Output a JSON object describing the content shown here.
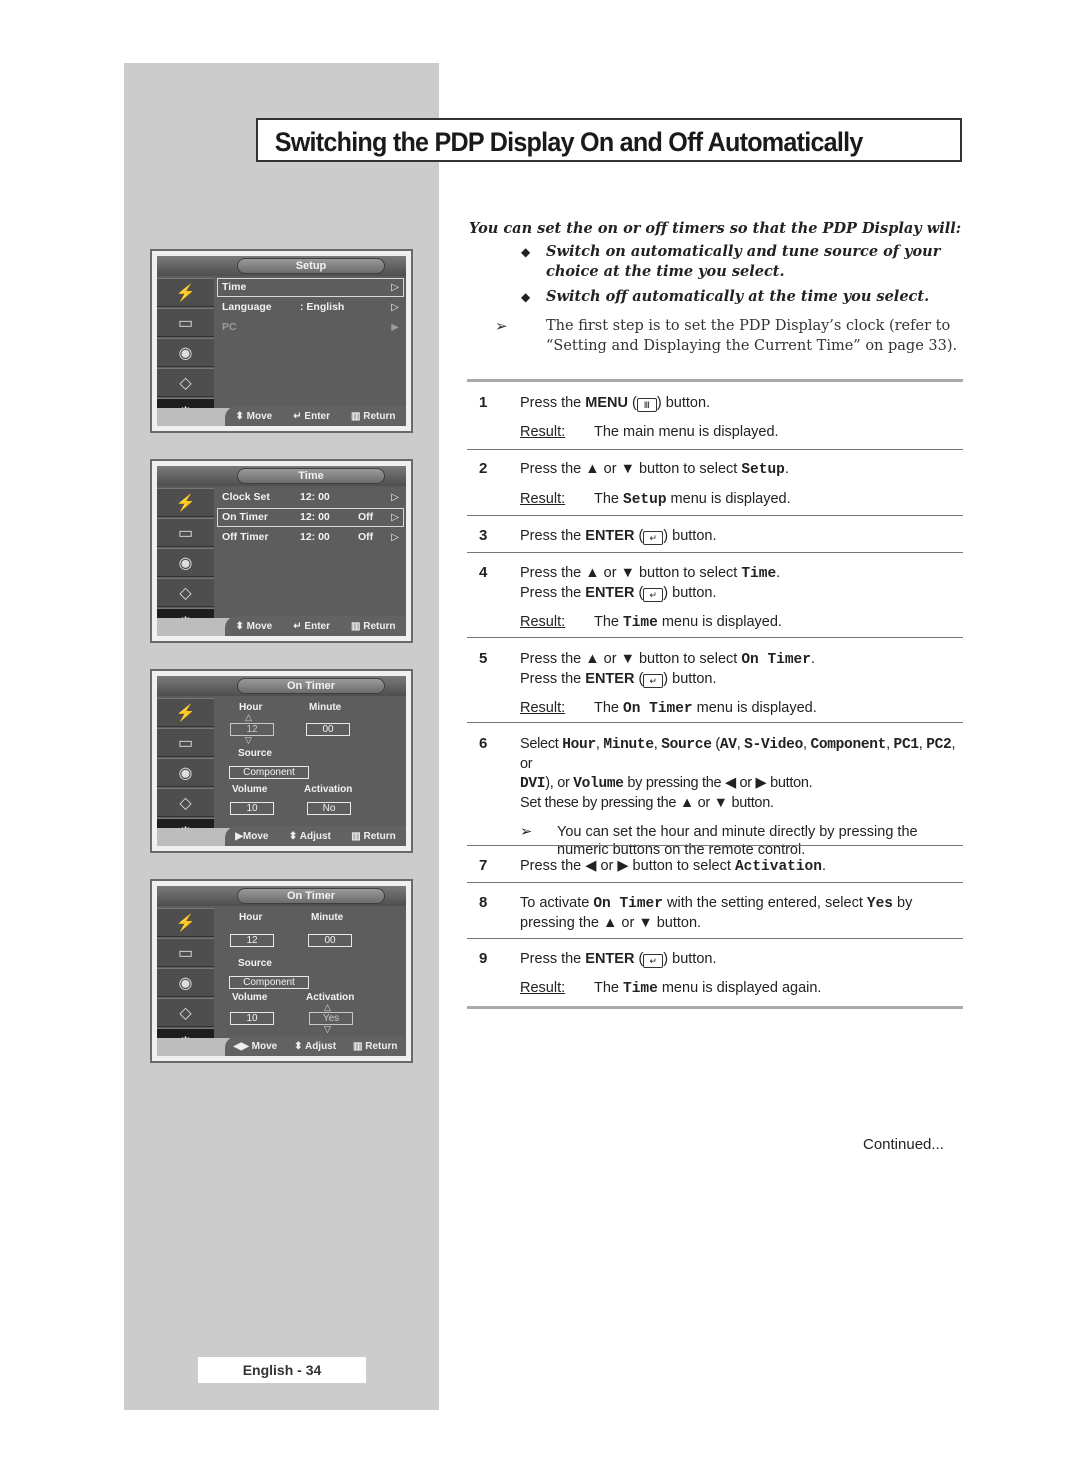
{
  "page": {
    "title": "Switching the PDP Display On and Off Automatically",
    "page_number": "English - 34",
    "continued": "Continued..."
  },
  "intro": {
    "lead": "You can set the on or off timers so that the PDP Display will:",
    "bullets": [
      "Switch on automatically and tune source of your choice at the time you select.",
      "Switch off automatically at the time you select."
    ],
    "note": "The first step is to set the PDP Display’s clock (refer to “Setting and Displaying the Current Time” on page 33)."
  },
  "symbols": {
    "diamond": "◆",
    "arrow_note": "➢",
    "up": "▲",
    "down": "▼",
    "left": "◀",
    "right": "▶",
    "menu_icon": "▥",
    "enter_icon": "↵"
  },
  "result_label": "Result:",
  "steps": [
    {
      "num": "1",
      "parts": [
        "Press the ",
        "MENU",
        " (",
        ") button."
      ],
      "result": "The main menu is displayed."
    },
    {
      "num": "2",
      "text": "Press the ▲ or ▼ button to select ",
      "code": "Setup",
      "tail": ".",
      "result_pre": "The ",
      "result_code": "Setup",
      "result_post": " menu is displayed."
    },
    {
      "num": "3",
      "parts": [
        "Press the ",
        "ENTER",
        " (",
        ") button."
      ]
    },
    {
      "num": "4",
      "text": "Press the ▲ or ▼ button to select ",
      "code": "Time",
      "tail": ".",
      "line2": [
        "Press the ",
        "ENTER",
        " (",
        ") button."
      ],
      "result_pre": "The ",
      "result_code": "Time",
      "result_post": " menu is displayed."
    },
    {
      "num": "5",
      "text": "Press the ▲ or ▼ button to select ",
      "code": "On Timer",
      "tail": ".",
      "line2": [
        "Press the ",
        "ENTER",
        " (",
        ") button."
      ],
      "result_pre": "The ",
      "result_code": "On Timer",
      "result_post": " menu is displayed."
    },
    {
      "num": "6",
      "select": "Select ",
      "c1": "Hour",
      "s1": ", ",
      "c2": "Minute",
      "s2": ", ",
      "c3": "Source",
      "s3": " (",
      "c4": "AV",
      "s4": ", ",
      "c5": "S-Video",
      "s5": ", ",
      "c6": "Component",
      "s6": ", ",
      "c7": "PC1",
      "s7": ", ",
      "c8": "PC2",
      "s8": ", or",
      "c9": "DVI",
      "s9": "), or ",
      "c10": "Volume",
      "s10": " by pressing the ◀ or ▶ button.",
      "line3": "Set these by pressing the ▲ or ▼ button.",
      "note": "You can set the hour and minute directly by pressing the numeric buttons on the remote control."
    },
    {
      "num": "7",
      "text": "Press the ◀ or ▶ button to select ",
      "code": "Activation",
      "tail": "."
    },
    {
      "num": "8",
      "pre": "To activate ",
      "code": "On Timer",
      "mid": " with the setting entered, select ",
      "code2": "Yes",
      "post": " by pressing the ▲ or ▼ button."
    },
    {
      "num": "9",
      "parts": [
        "Press the ",
        "ENTER",
        " (",
        ") button."
      ],
      "result_pre": "The ",
      "result_code": "Time",
      "result_post": " menu is displayed again."
    }
  ],
  "osd": {
    "footer_a": {
      "move": "Move",
      "enter": "Enter",
      "return": "Return"
    },
    "footer_b": {
      "move": "Move",
      "adjust": "Adjust",
      "return": "Return"
    },
    "setup": {
      "title": "Setup",
      "rows": [
        {
          "label": "Time",
          "value": "",
          "selected": true
        },
        {
          "label": "Language",
          "value": ": English"
        },
        {
          "label": "PC",
          "value": "",
          "disabled": true
        }
      ]
    },
    "time": {
      "title": "Time",
      "rows": [
        {
          "label": "Clock Set",
          "value": "12: 00",
          "state": ""
        },
        {
          "label": "On Timer",
          "value": "12: 00",
          "state": "Off",
          "selected": true
        },
        {
          "label": "Off Timer",
          "value": "12: 00",
          "state": "Off"
        }
      ]
    },
    "on_timer_1": {
      "title": "On Timer",
      "hour_label": "Hour",
      "hour": "12",
      "minute_label": "Minute",
      "minute": "00",
      "source_label": "Source",
      "source": "Component",
      "volume_label": "Volume",
      "volume": "10",
      "activation_label": "Activation",
      "activation": "No"
    },
    "on_timer_2": {
      "title": "On Timer",
      "hour_label": "Hour",
      "hour": "12",
      "minute_label": "Minute",
      "minute": "00",
      "source_label": "Source",
      "source": "Component",
      "volume_label": "Volume",
      "volume": "10",
      "activation_label": "Activation",
      "activation": "Yes"
    }
  }
}
